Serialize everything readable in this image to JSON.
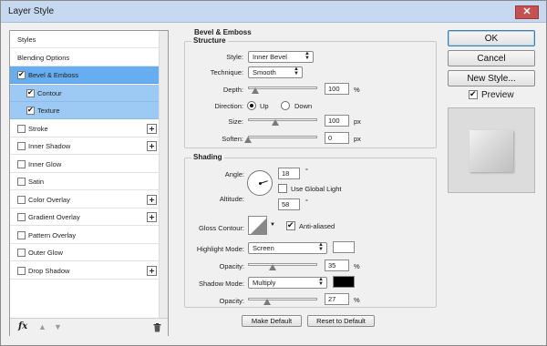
{
  "window": {
    "title": "Layer Style",
    "close_glyph": "✕"
  },
  "styles_panel": {
    "items": [
      {
        "label": "Styles",
        "checkbox": false,
        "checked": false,
        "plus": false,
        "state": "normal"
      },
      {
        "label": "Blending Options",
        "checkbox": false,
        "checked": false,
        "plus": false,
        "state": "normal"
      },
      {
        "label": "Bevel & Emboss",
        "checkbox": true,
        "checked": true,
        "plus": false,
        "state": "active"
      },
      {
        "label": "Contour",
        "checkbox": true,
        "checked": true,
        "plus": false,
        "state": "subsel"
      },
      {
        "label": "Texture",
        "checkbox": true,
        "checked": true,
        "plus": false,
        "state": "subsel"
      },
      {
        "label": "Stroke",
        "checkbox": true,
        "checked": false,
        "plus": true,
        "state": "normal"
      },
      {
        "label": "Inner Shadow",
        "checkbox": true,
        "checked": false,
        "plus": true,
        "state": "normal"
      },
      {
        "label": "Inner Glow",
        "checkbox": true,
        "checked": false,
        "plus": false,
        "state": "normal"
      },
      {
        "label": "Satin",
        "checkbox": true,
        "checked": false,
        "plus": false,
        "state": "normal"
      },
      {
        "label": "Color Overlay",
        "checkbox": true,
        "checked": false,
        "plus": true,
        "state": "normal"
      },
      {
        "label": "Gradient Overlay",
        "checkbox": true,
        "checked": false,
        "plus": true,
        "state": "normal"
      },
      {
        "label": "Pattern Overlay",
        "checkbox": true,
        "checked": false,
        "plus": false,
        "state": "normal"
      },
      {
        "label": "Outer Glow",
        "checkbox": true,
        "checked": false,
        "plus": false,
        "state": "normal"
      },
      {
        "label": "Drop Shadow",
        "checkbox": true,
        "checked": false,
        "plus": true,
        "state": "normal"
      }
    ],
    "footer": {
      "fx_label": "fx",
      "up_glyph": "▲",
      "down_glyph": "▼"
    }
  },
  "bevel_emboss": {
    "title": "Bevel & Emboss",
    "structure": {
      "legend": "Structure",
      "style_label": "Style:",
      "style_value": "Inner Bevel",
      "technique_label": "Technique:",
      "technique_value": "Smooth",
      "depth_label": "Depth:",
      "depth_value": "100",
      "depth_unit": "%",
      "depth_level": 0.1,
      "direction_label": "Direction:",
      "direction_up": "Up",
      "direction_down": "Down",
      "size_label": "Size:",
      "size_value": "100",
      "size_unit": "px",
      "size_level": 0.4,
      "soften_label": "Soften:",
      "soften_value": "0",
      "soften_unit": "px",
      "soften_level": 0.0
    },
    "shading": {
      "legend": "Shading",
      "angle_label": "Angle:",
      "angle_value": "18",
      "angle_unit": "°",
      "global_light_label": "Use Global Light",
      "altitude_label": "Altitude:",
      "altitude_value": "58",
      "altitude_unit": "°",
      "gloss_contour_label": "Gloss Contour:",
      "anti_aliased_label": "Anti-aliased",
      "highlight_mode_label": "Highlight Mode:",
      "highlight_mode_value": "Screen",
      "highlight_color": "#ffffff",
      "highlight_opacity_label": "Opacity:",
      "highlight_opacity_value": "35",
      "highlight_opacity_unit": "%",
      "highlight_opacity_level": 0.35,
      "shadow_mode_label": "Shadow Mode:",
      "shadow_mode_value": "Multiply",
      "shadow_color": "#000000",
      "shadow_opacity_label": "Opacity:",
      "shadow_opacity_value": "27",
      "shadow_opacity_unit": "%",
      "shadow_opacity_level": 0.27
    },
    "make_default_label": "Make Default",
    "reset_default_label": "Reset to Default"
  },
  "actions": {
    "ok_label": "OK",
    "cancel_label": "Cancel",
    "new_style_label": "New Style...",
    "preview_label": "Preview"
  }
}
